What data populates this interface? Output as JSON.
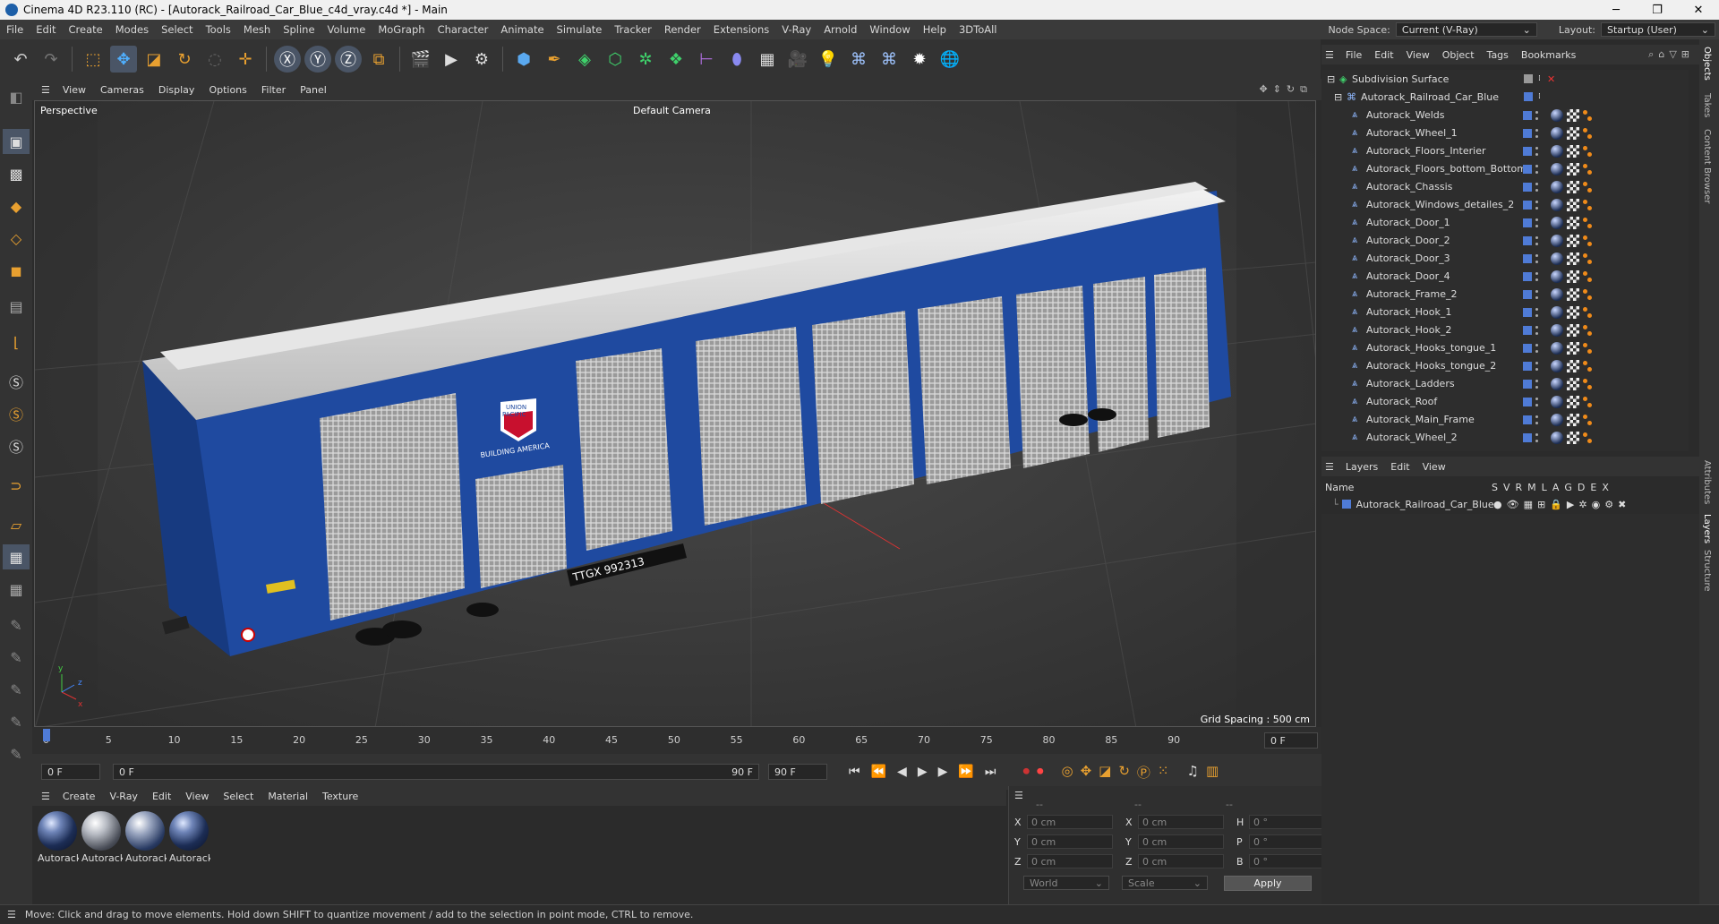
{
  "window": {
    "title": "Cinema 4D R23.110 (RC) - [Autorack_Railroad_Car_Blue_c4d_vray.c4d *] - Main",
    "minimize": "─",
    "maximize": "❐",
    "close": "✕"
  },
  "menubar": {
    "items": [
      "File",
      "Edit",
      "Create",
      "Modes",
      "Select",
      "Tools",
      "Mesh",
      "Spline",
      "Volume",
      "MoGraph",
      "Character",
      "Animate",
      "Simulate",
      "Tracker",
      "Render",
      "Extensions",
      "V-Ray",
      "Arnold",
      "Window",
      "Help",
      "3DToAll"
    ],
    "node_space_label": "Node Space:",
    "node_space_value": "Current (V-Ray)",
    "layout_label": "Layout:",
    "layout_value": "Startup (User)"
  },
  "viewport": {
    "menu": [
      "View",
      "Cameras",
      "Display",
      "Options",
      "Filter",
      "Panel"
    ],
    "name": "Perspective",
    "camera": "Default Camera",
    "grid_spacing": "Grid Spacing : 500 cm",
    "car_number": "TTGX 992313",
    "logo_top": "UNION",
    "logo_mid": "PACIFIC",
    "logo_sub": "BUILDING AMERICA"
  },
  "timeline": {
    "ticks": [
      "0",
      "5",
      "10",
      "15",
      "20",
      "25",
      "30",
      "35",
      "40",
      "45",
      "50",
      "55",
      "60",
      "65",
      "70",
      "75",
      "80",
      "85",
      "90"
    ],
    "current_frame_right": "0 F",
    "start_frame": "0 F",
    "current_frame": "0 F",
    "end_frame_inner": "90 F",
    "end_frame": "90 F"
  },
  "materials": {
    "menu": [
      "Create",
      "V-Ray",
      "Edit",
      "View",
      "Select",
      "Material",
      "Texture"
    ],
    "items": [
      "Autorack",
      "Autorack",
      "Autorack",
      "Autorack"
    ]
  },
  "coordinates": {
    "header_left": "--",
    "header_mid": "--",
    "header_right": "--",
    "rows": [
      {
        "a": "X",
        "av": "0 cm",
        "b": "X",
        "bv": "0 cm",
        "c": "H",
        "cv": "0 °"
      },
      {
        "a": "Y",
        "av": "0 cm",
        "b": "Y",
        "bv": "0 cm",
        "c": "P",
        "cv": "0 °"
      },
      {
        "a": "Z",
        "av": "0 cm",
        "b": "Z",
        "bv": "0 cm",
        "c": "B",
        "cv": "0 °"
      }
    ],
    "space": "World",
    "mode": "Scale",
    "apply": "Apply"
  },
  "status": "Move: Click and drag to move elements. Hold down SHIFT to quantize movement / add to the selection in point mode, CTRL to remove.",
  "object_manager": {
    "menu": [
      "File",
      "Edit",
      "View",
      "Object",
      "Tags",
      "Bookmarks"
    ],
    "root": "Subdivision Surface",
    "group": "Autorack_Railroad_Car_Blue",
    "objects": [
      "Autorack_Welds",
      "Autorack_Wheel_1",
      "Autorack_Floors_Interier",
      "Autorack_Floors_bottom_Bottom",
      "Autorack_Chassis",
      "Autorack_Windows_detailes_2",
      "Autorack_Door_1",
      "Autorack_Door_2",
      "Autorack_Door_3",
      "Autorack_Door_4",
      "Autorack_Frame_2",
      "Autorack_Hook_1",
      "Autorack_Hook_2",
      "Autorack_Hooks_tongue_1",
      "Autorack_Hooks_tongue_2",
      "Autorack_Ladders",
      "Autorack_Roof",
      "Autorack_Main_Frame",
      "Autorack_Wheel_2"
    ]
  },
  "layers": {
    "menu": [
      "Layers",
      "Edit",
      "View"
    ],
    "name_col": "Name",
    "cols": [
      "S",
      "V",
      "R",
      "M",
      "L",
      "A",
      "G",
      "D",
      "E",
      "X"
    ],
    "layer": "Autorack_Railroad_Car_Blue"
  },
  "right_tabs": [
    "Objects",
    "Takes",
    "Content Browser",
    "Attributes",
    "Layers",
    "Structure"
  ],
  "colors": {
    "accent": "#4f7bd6",
    "car_blue": "#1f4aa0",
    "roof": "#d8d8d8",
    "ui_bg": "#2b2b2b"
  }
}
